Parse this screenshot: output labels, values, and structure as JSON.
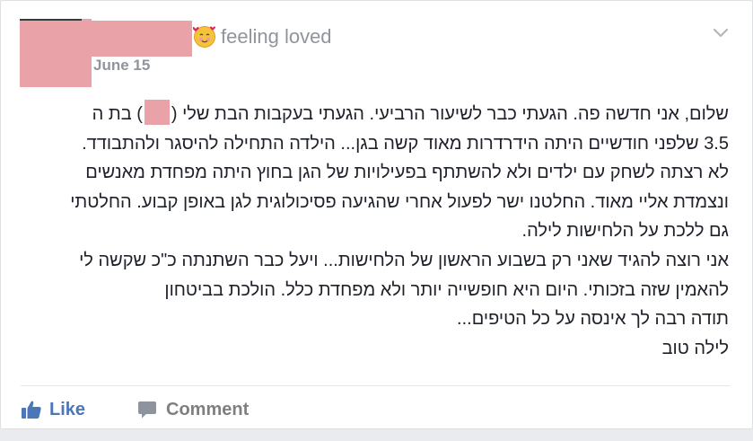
{
  "post": {
    "feeling_text": "feeling loved",
    "date": "June 15",
    "paragraphs": [
      {
        "before": "שלום, אני חדשה פה. הגעתי כבר לשיעור הרביעי. הגעתי בעקבות הבת שלי (",
        "after": ") בת ה"
      },
      {
        "text": "3.5 שלפני חודשיים היתה הידרדרות מאוד קשה בגן... הילדה התחילה להיסגר ולהתבודד."
      },
      {
        "text": "לא רצתה לשחק עם ילדים ולא להשתתף בפעילויות של הגן בחוץ היתה מפחדת מאנשים"
      },
      {
        "text": "ונצמדת אליי מאוד. החלטנו ישר לפעול אחרי שהגיעה פסיכולוגית לגן באופן קבוע. החלטתי"
      },
      {
        "text": "גם ללכת על הלחישות לילה."
      },
      {
        "text": "אני רוצה להגיד שאני רק בשבוע הראשון של הלחישות... ויעל כבר השתנתה כ\"כ שקשה לי"
      },
      {
        "text": "להאמין שזה בזכותי. היום היא חופשייה יותר ולא מפחדת כלל. הולכת בביטחון"
      },
      {
        "text": "תודה רבה לך אינסה על כל הטיפים..."
      },
      {
        "text": "לילה טוב"
      }
    ]
  },
  "actions": {
    "like_label": "Like",
    "comment_label": "Comment"
  },
  "icons": {
    "feeling": "smiling-face-with-hearts-icon",
    "menu": "chevron-down-icon",
    "like": "thumbs-up-icon",
    "comment": "speech-bubble-icon"
  },
  "colors": {
    "redaction": "#e8a2a8",
    "link_blue": "#4b76b8",
    "meta_gray": "#90949c",
    "text": "#1d2129"
  }
}
